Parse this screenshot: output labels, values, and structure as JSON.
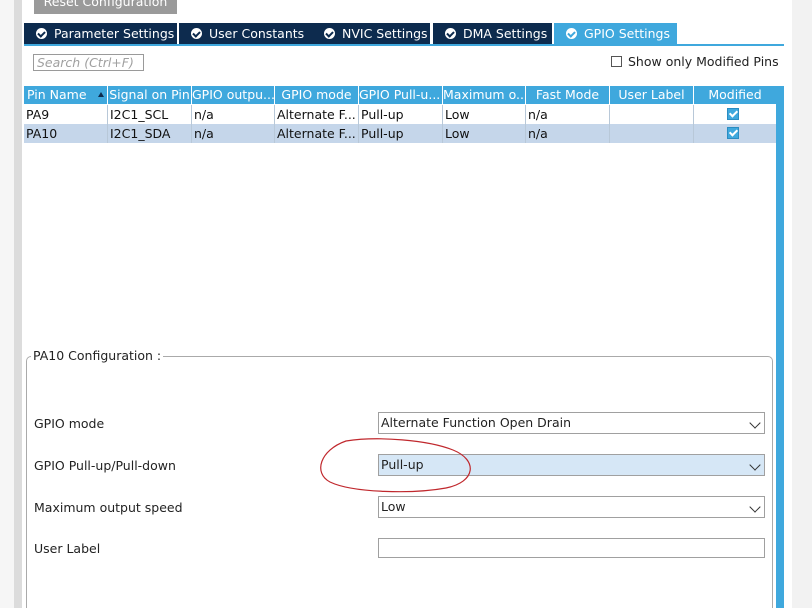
{
  "toolbar": {
    "reset_label": "Reset Configuration"
  },
  "tabs": [
    {
      "label": "Parameter Settings",
      "active": false
    },
    {
      "label": "User Constants",
      "active": false
    },
    {
      "label": "NVIC Settings",
      "active": false
    },
    {
      "label": "DMA Settings",
      "active": false
    },
    {
      "label": "GPIO Settings",
      "active": true
    }
  ],
  "search": {
    "placeholder": "Search (Ctrl+F)",
    "value": ""
  },
  "show_modified": {
    "label": "Show only Modified Pins",
    "checked": false
  },
  "table": {
    "columns": [
      "Pin Name",
      "Signal on Pin",
      "GPIO outpu...",
      "GPIO mode",
      "GPIO Pull-u...",
      "Maximum o...",
      "Fast Mode",
      "User Label",
      "Modified"
    ],
    "rows": [
      {
        "pin": "PA9",
        "signal": "I2C1_SCL",
        "output": "n/a",
        "mode": "Alternate F...",
        "pull": "Pull-up",
        "speed": "Low",
        "fast": "n/a",
        "label": "",
        "modified": true,
        "selected": false
      },
      {
        "pin": "PA10",
        "signal": "I2C1_SDA",
        "output": "n/a",
        "mode": "Alternate F...",
        "pull": "Pull-up",
        "speed": "Low",
        "fast": "n/a",
        "label": "",
        "modified": true,
        "selected": true
      }
    ]
  },
  "config": {
    "title": "PA10 Configuration :",
    "gpio_mode": {
      "label": "GPIO mode",
      "value": "Alternate Function Open Drain"
    },
    "pull": {
      "label": "GPIO Pull-up/Pull-down",
      "value": "Pull-up"
    },
    "speed": {
      "label": "Maximum output speed",
      "value": "Low"
    },
    "user_label": {
      "label": "User Label",
      "value": ""
    }
  },
  "colors": {
    "tab_bg": "#0d2b4e",
    "accent": "#3fa8dd",
    "selected_row": "#c5d6ea",
    "annotation": "#c0282d"
  }
}
